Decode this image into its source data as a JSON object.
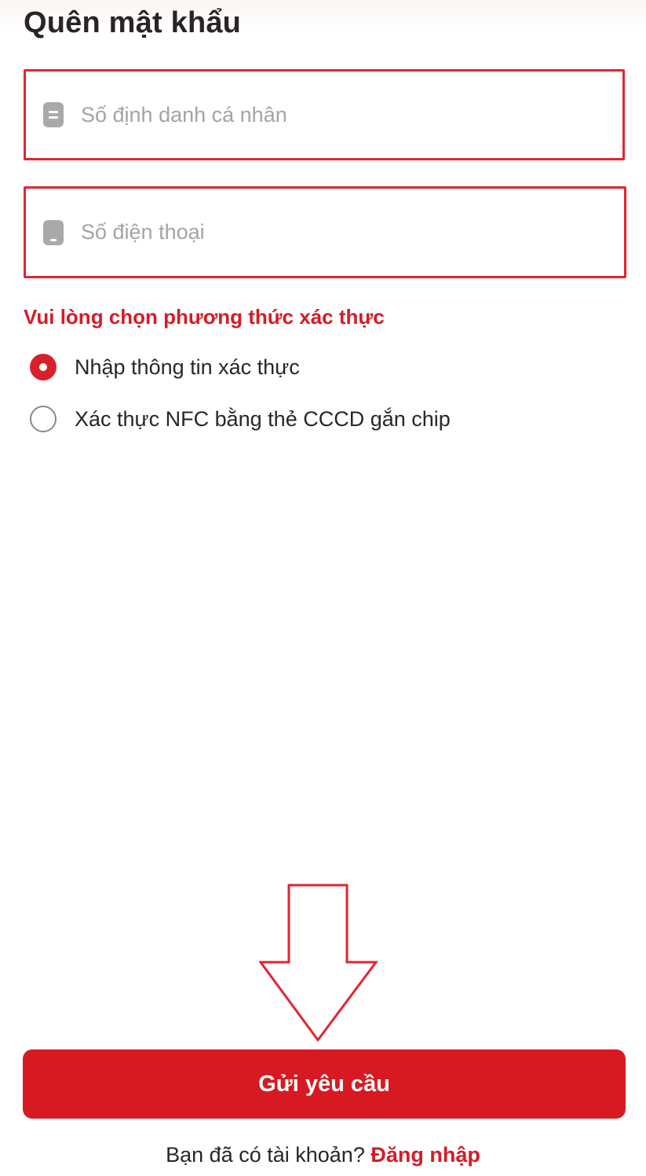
{
  "page": {
    "title": "Quên mật khẩu"
  },
  "form": {
    "id_field": {
      "placeholder": "Số định danh cá nhân",
      "icon": "id-card-icon"
    },
    "phone_field": {
      "placeholder": "Số điện thoại",
      "icon": "phone-icon"
    }
  },
  "verification": {
    "label": "Vui lòng chọn phương thức xác thực",
    "options": [
      {
        "label": "Nhập thông tin xác thực",
        "selected": true
      },
      {
        "label": "Xác thực NFC bằng thẻ CCCD gắn chip",
        "selected": false
      }
    ]
  },
  "submit": {
    "label": "Gửi yêu cầu"
  },
  "footer": {
    "prompt": "Bạn đã có tài khoản?",
    "login_link": "Đăng nhập"
  },
  "colors": {
    "accent": "#d71a22",
    "annotation": "#e22530"
  }
}
